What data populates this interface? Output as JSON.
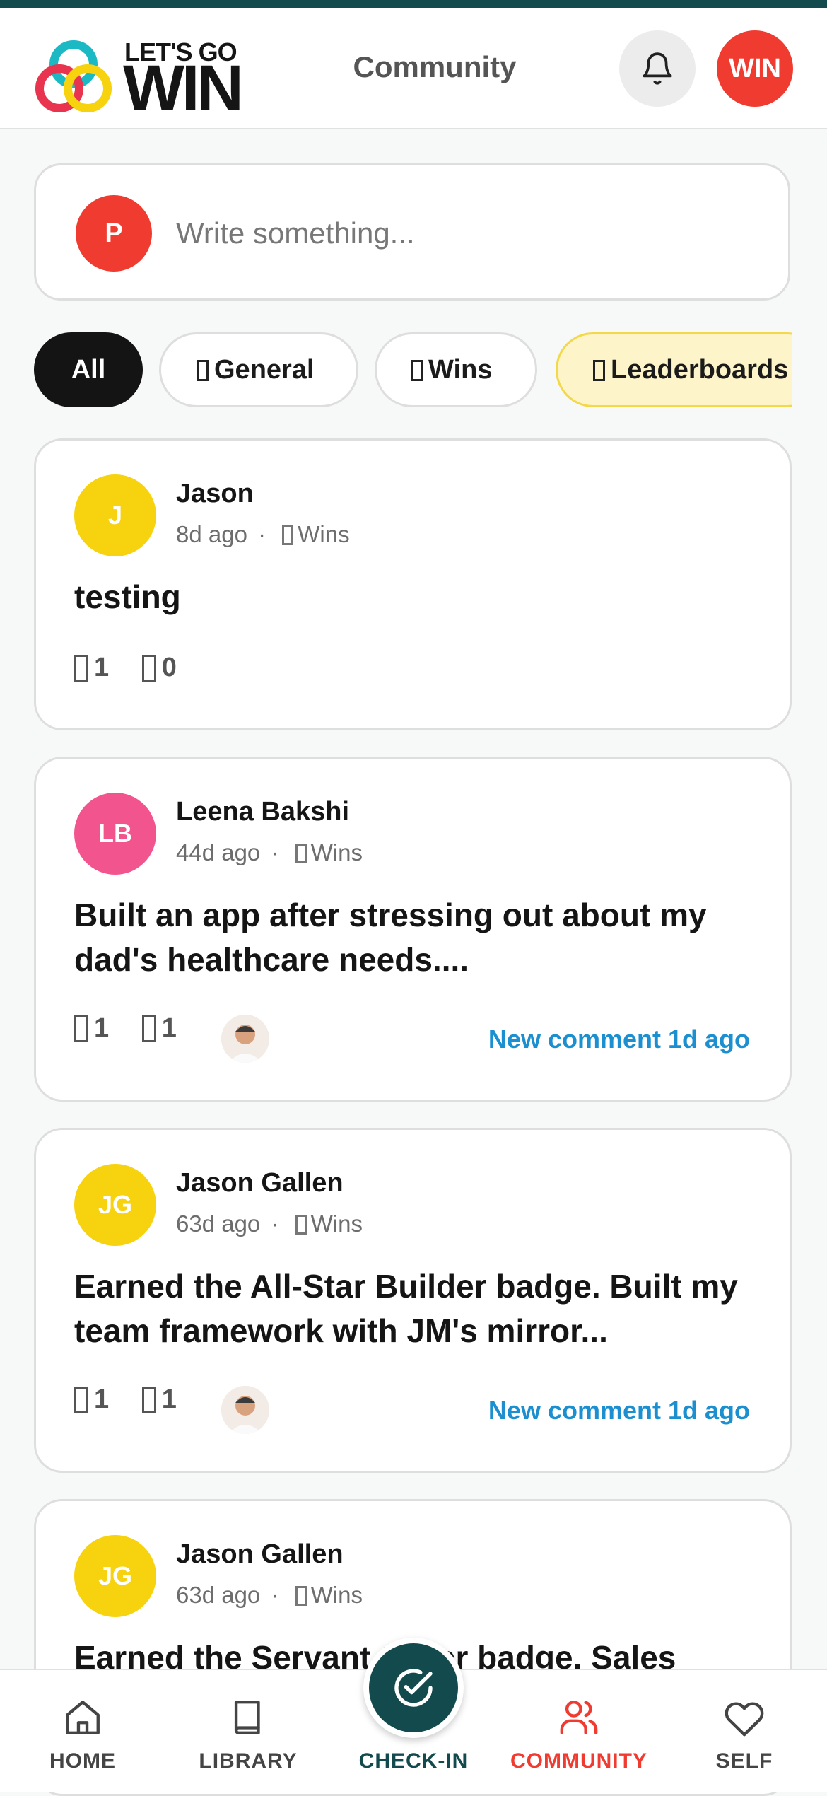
{
  "header": {
    "logo_small": "LET'S GO",
    "logo_big": "WIN",
    "title": "Community",
    "notifications_icon": "bell-icon",
    "profile_button_label": "WIN"
  },
  "composer": {
    "avatar_initial": "P",
    "placeholder": "Write something..."
  },
  "filters": [
    {
      "label": "All",
      "active": true
    },
    {
      "label": "General",
      "icon": "unknown-icon"
    },
    {
      "label": "Wins",
      "icon": "unknown-icon"
    },
    {
      "label": "Leaderboards",
      "icon": "unknown-icon",
      "highlight": true
    }
  ],
  "posts": [
    {
      "initials": "J",
      "author": "Jason",
      "age": "8d ago",
      "separator": "·",
      "category": "Wins",
      "text": "testing",
      "likes": "1",
      "comments": "0",
      "avatar_color": "#f7d20e"
    },
    {
      "initials": "LB",
      "author": "Leena Bakshi",
      "age": "44d ago",
      "separator": "·",
      "category": "Wins",
      "text": "Built an app after stressing out about my dad's healthcare needs....",
      "likes": "1",
      "comments": "1",
      "new_comment": "New comment 1d ago",
      "avatar_color": "#f2558e"
    },
    {
      "initials": "JG",
      "author": "Jason Gallen",
      "age": "63d ago",
      "separator": "·",
      "category": "Wins",
      "text": "Earned the All-Star Builder badge. Built my team framework with JM's mirror...",
      "likes": "1",
      "comments": "1",
      "new_comment": "New comment 1d ago",
      "avatar_color": "#f7d20e"
    },
    {
      "initials": "JG",
      "author": "Jason Gallen",
      "age": "63d ago",
      "separator": "·",
      "category": "Wins",
      "text": "Earned the Servant Seller badge. Sales",
      "avatar_color": "#f7d20e"
    }
  ],
  "bottom_nav": [
    {
      "label": "HOME",
      "icon": "home-icon"
    },
    {
      "label": "LIBRARY",
      "icon": "book-icon"
    },
    {
      "label": "CHECK-IN",
      "icon": "check-circle-icon"
    },
    {
      "label": "COMMUNITY",
      "icon": "users-icon",
      "active": true
    },
    {
      "label": "SELF",
      "icon": "heart-icon"
    }
  ],
  "colors": {
    "accent_red": "#ef3b30",
    "teal": "#124a4e",
    "link_blue": "#1b8fcf",
    "yellow": "#f7d20e",
    "pink": "#f2558e"
  }
}
